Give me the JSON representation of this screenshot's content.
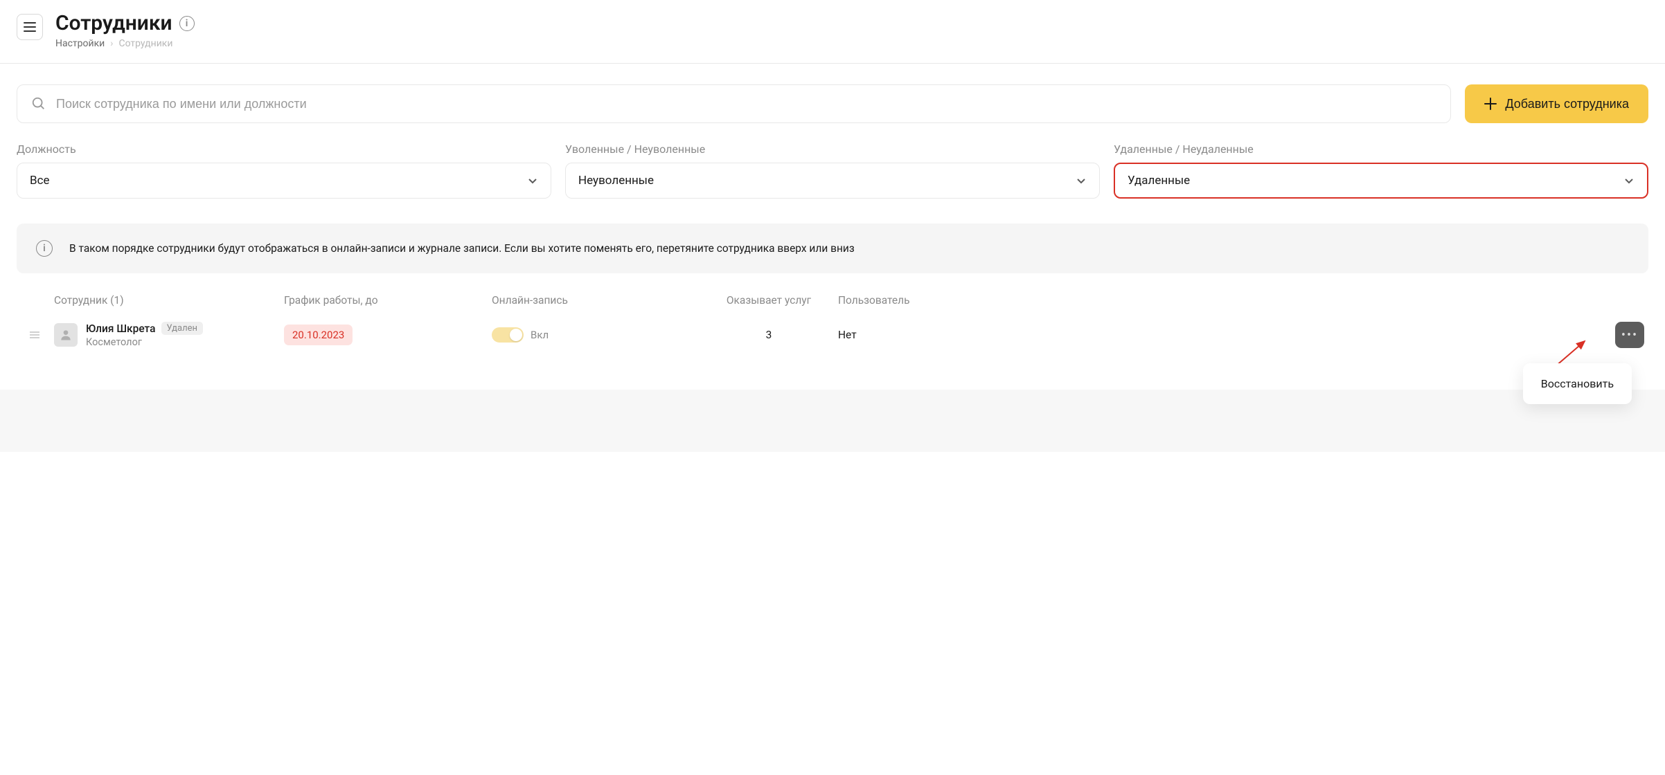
{
  "header": {
    "title": "Сотрудники",
    "breadcrumb": {
      "root": "Настройки",
      "current": "Сотрудники"
    }
  },
  "toolbar": {
    "search_placeholder": "Поиск сотрудника по имени или должности",
    "add_label": "Добавить сотрудника"
  },
  "filters": {
    "position": {
      "label": "Должность",
      "value": "Все"
    },
    "fired": {
      "label": "Уволенные / Неуволенные",
      "value": "Неуволенные"
    },
    "deleted": {
      "label": "Удаленные / Неудаленные",
      "value": "Удаленные"
    }
  },
  "info_banner": "В таком порядке сотрудники будут отображаться в онлайн-записи и журнале записи. Если вы хотите поменять его, перетяните сотрудника вверх или вниз",
  "table": {
    "headers": {
      "employee": "Сотрудник (1)",
      "schedule": "График работы, до",
      "online": "Онлайн-запись",
      "services": "Оказывает услуг",
      "user": "Пользователь"
    },
    "rows": [
      {
        "name": "Юлия Шкрета",
        "status": "Удален",
        "role": "Косметолог",
        "schedule_until": "20.10.2023",
        "online_label": "Вкл",
        "services_count": "3",
        "user": "Нет"
      }
    ]
  },
  "dropdown": {
    "restore": "Восстановить"
  }
}
